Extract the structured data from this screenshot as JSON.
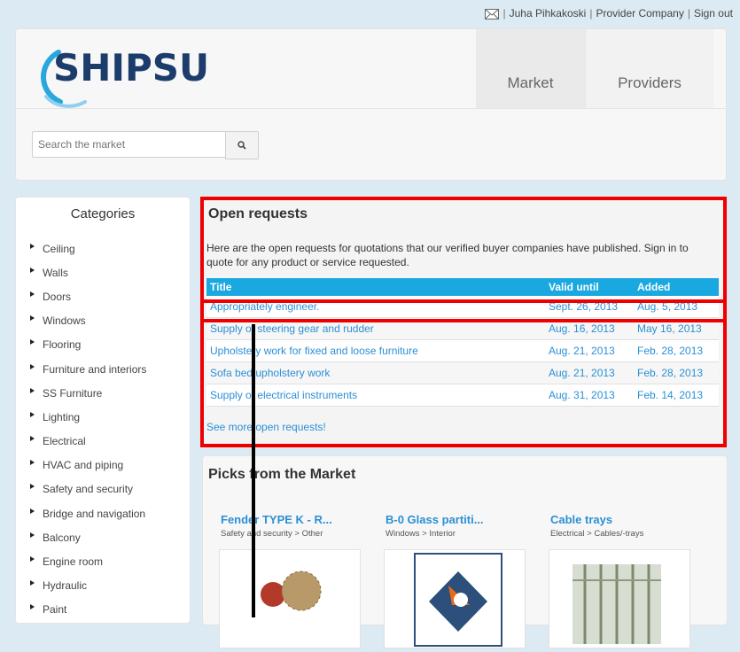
{
  "topbar": {
    "user": "Juha Pihkakoski",
    "company": "Provider Company",
    "signout": "Sign out",
    "sep": "|"
  },
  "header": {
    "logo": "SHIPSU",
    "nav": [
      "Market",
      "Providers"
    ]
  },
  "search": {
    "placeholder": "Search the market"
  },
  "sidebar": {
    "title": "Categories",
    "items": [
      "Ceiling",
      "Walls",
      "Doors",
      "Windows",
      "Flooring",
      "Furniture and interiors",
      "SS Furniture",
      "Lighting",
      "Electrical",
      "HVAC and piping",
      "Safety and security",
      "Bridge and navigation",
      "Balcony",
      "Engine room",
      "Hydraulic",
      "Paint"
    ]
  },
  "open_requests": {
    "title": "Open requests",
    "intro": "Here are the open requests for quotations that our verified buyer companies have published. Sign in to quote for any product or service requested.",
    "headers": [
      "Title",
      "Valid until",
      "Added"
    ],
    "rows": [
      [
        "Appropriately engineer.",
        "Sept. 26, 2013",
        "Aug. 5, 2013"
      ],
      [
        "Supply of steering gear and rudder",
        "Aug. 16, 2013",
        "May 16, 2013"
      ],
      [
        "Upholstery work for fixed and loose furniture",
        "Aug. 21, 2013",
        "Feb. 28, 2013"
      ],
      [
        "Sofa bed upholstery work",
        "Aug. 21, 2013",
        "Feb. 28, 2013"
      ],
      [
        "Supply of electrical instruments",
        "Aug. 31, 2013",
        "Feb. 14, 2013"
      ]
    ],
    "see_more": "See more open requests!"
  },
  "picks": {
    "title": "Picks from the Market",
    "items": [
      {
        "title": "Fender TYPE K - R...",
        "category": "Safety and security > Other"
      },
      {
        "title": "B-0 Glass partiti...",
        "category": "Windows > Interior"
      },
      {
        "title": "Cable trays",
        "category": "Electrical > Cables/-trays"
      }
    ]
  },
  "colors": {
    "accent": "#1aa8e0",
    "link": "#2b8fd6",
    "highlight": "#ee0000",
    "logo": "#1c3c6b"
  }
}
